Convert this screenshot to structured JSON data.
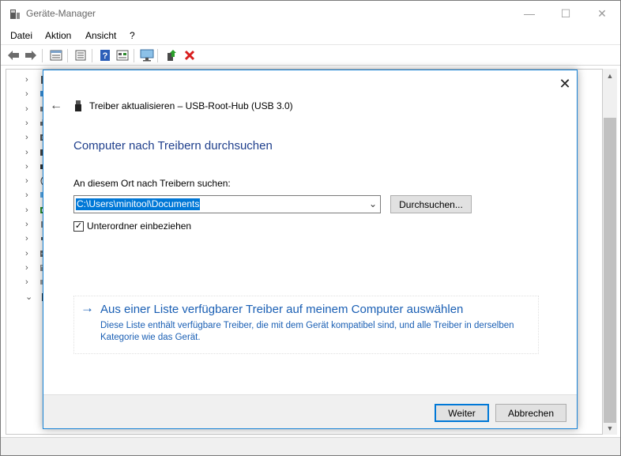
{
  "window": {
    "title": "Geräte-Manager",
    "minimize_label": "—",
    "maximize_label": "☐",
    "close_label": "✕"
  },
  "menu": {
    "items": [
      {
        "label": "Datei"
      },
      {
        "label": "Aktion"
      },
      {
        "label": "Ansicht"
      },
      {
        "label": "?"
      }
    ]
  },
  "toolbar": {
    "buttons": [
      {
        "icon": "back-arrow-icon"
      },
      {
        "icon": "forward-arrow-icon"
      },
      {
        "icon": "properties-icon"
      },
      {
        "icon": "view-list-icon"
      },
      {
        "icon": "help-icon"
      },
      {
        "icon": "show-hidden-icon"
      },
      {
        "icon": "monitor-scan-icon"
      },
      {
        "icon": "update-driver-icon"
      },
      {
        "icon": "uninstall-icon"
      }
    ]
  },
  "tree": {
    "rows": [
      {
        "chevron": "›",
        "icon": "device-icon"
      },
      {
        "chevron": "›",
        "icon": "computer-icon"
      },
      {
        "chevron": "›",
        "icon": "drive-icon"
      },
      {
        "chevron": "›",
        "icon": "printer-icon"
      },
      {
        "chevron": "›",
        "icon": "controller-icon"
      },
      {
        "chevron": "›",
        "icon": "network-icon"
      },
      {
        "chevron": "›",
        "icon": "ports-icon"
      },
      {
        "chevron": "›",
        "icon": "mouse-icon"
      },
      {
        "chevron": "›",
        "icon": "monitor-icon"
      },
      {
        "chevron": "›",
        "icon": "keyboard-icon"
      },
      {
        "chevron": "›",
        "icon": "chip-icon"
      },
      {
        "chevron": "›",
        "icon": "sound-icon"
      },
      {
        "chevron": "›",
        "icon": "storage-icon"
      },
      {
        "chevron": "›",
        "icon": "system-icon"
      },
      {
        "chevron": "›",
        "icon": "bus-icon"
      },
      {
        "chevron": "⌄",
        "icon": "usb-icon"
      }
    ]
  },
  "dialog": {
    "close_label": "✕",
    "back_label": "←",
    "header_title": "Treiber aktualisieren – USB-Root-Hub (USB 3.0)",
    "heading": "Computer nach Treibern durchsuchen",
    "search_label": "An diesem Ort nach Treibern suchen:",
    "path_value": "C:\\Users\\minitool\\Documents",
    "combo_arrow": "⌄",
    "browse_label": "Durchsuchen...",
    "checkbox_label": "Unterordner einbeziehen",
    "checkbox_checked": true,
    "checkbox_mark": "✓",
    "link_arrow": "→",
    "link_title": "Aus einer Liste verfügbarer Treiber auf meinem Computer auswählen",
    "link_desc": "Diese Liste enthält verfügbare Treiber, die mit dem Gerät kompatibel sind, und alle Treiber in derselben Kategorie wie das Gerät.",
    "next_label": "Weiter",
    "cancel_label": "Abbrechen"
  },
  "colors": {
    "accent": "#0078d7",
    "heading": "#1f3f8c",
    "link": "#1a5fb4",
    "uninstall_red": "#d81e1e"
  }
}
